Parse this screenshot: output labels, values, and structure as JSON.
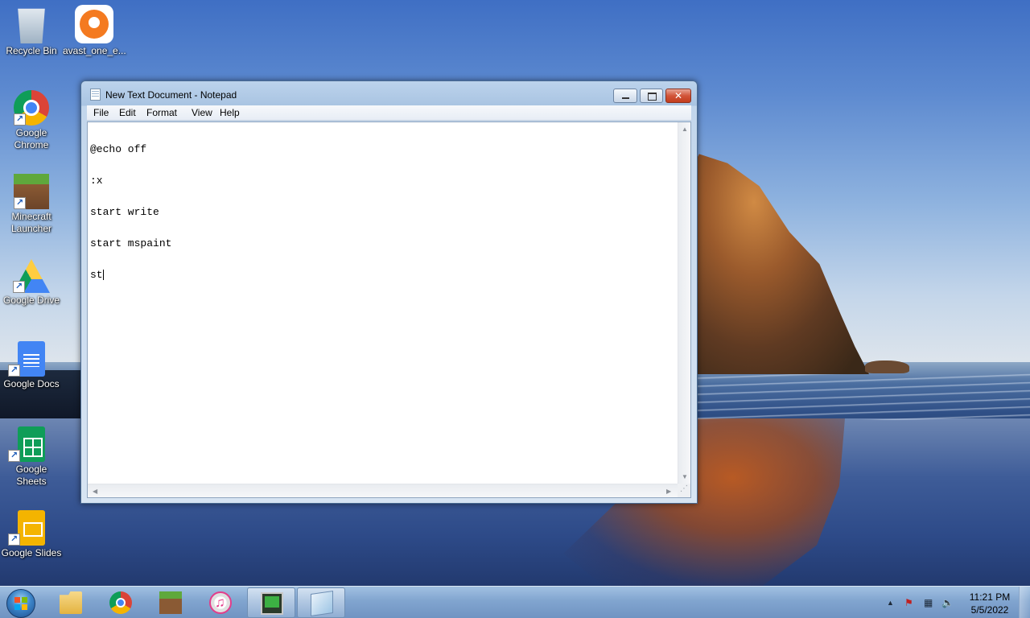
{
  "desktop": {
    "icons": [
      {
        "label": "Recycle Bin"
      },
      {
        "label": "avast_one_e..."
      },
      {
        "label": "Google Chrome"
      },
      {
        "label": "Minecraft Launcher"
      },
      {
        "label": "Google Drive"
      },
      {
        "label": "Google Docs"
      },
      {
        "label": "Google Sheets"
      },
      {
        "label": "Google Slides"
      }
    ]
  },
  "window": {
    "title": "New Text Document - Notepad",
    "close_glyph": "✕",
    "menu": [
      "File",
      "Edit",
      "Format",
      "View",
      "Help"
    ],
    "content_lines": [
      "@echo off",
      ":x",
      "start write",
      "start mspaint",
      "st"
    ]
  },
  "taskbar": {
    "pinned": [
      {
        "name": "windows-explorer"
      },
      {
        "name": "google-chrome"
      },
      {
        "name": "minecraft"
      },
      {
        "name": "itunes"
      },
      {
        "name": "system-monitor"
      },
      {
        "name": "notepad"
      }
    ],
    "tray": {
      "show_hidden_glyph": "▲",
      "flag_glyph": "⚑",
      "network_glyph": "▦",
      "volume_glyph": "🔈",
      "time": "11:21 PM",
      "date": "5/5/2022"
    }
  }
}
